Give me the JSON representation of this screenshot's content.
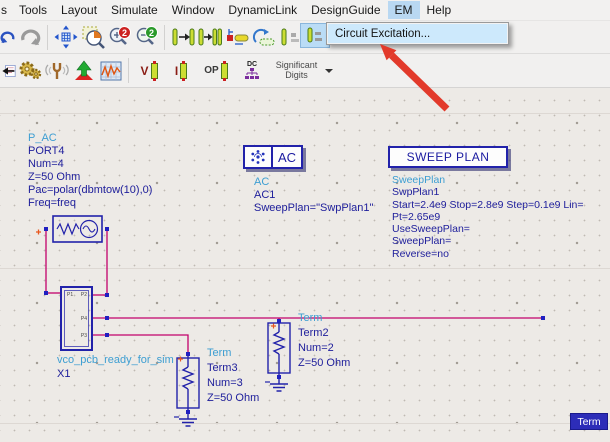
{
  "window": {
    "menu_items": [
      "s",
      "Tools",
      "Layout",
      "Simulate",
      "Window",
      "DynamicLink",
      "DesignGuide",
      "EM",
      "Help"
    ],
    "active_menu": "EM"
  },
  "em_menu": {
    "item": "Circuit Excitation..."
  },
  "toolbar_row1": {
    "icons": [
      "undo",
      "redo",
      "zoom-to-fit",
      "zoom-area",
      "zoom-in-2x",
      "zoom-out-2x",
      "insert-pin",
      "insert-pin-double",
      "push-into",
      "pop-out",
      "pin-tool-hovered"
    ]
  },
  "toolbar_row2": {
    "icons": [
      "back-annotate",
      "simulation-settings",
      "tune",
      "optimize",
      "data-display",
      "voltage-label",
      "current-label",
      "op-label",
      "dc-annotation"
    ],
    "significant_digits": "Significant Digits"
  },
  "schematic": {
    "port": {
      "name": "P_AC",
      "lines": [
        "PORT4",
        "Num=4",
        "Z=50 Ohm",
        "Pac=polar(dbmtow(10),0)",
        "Freq=freq"
      ]
    },
    "ac_ctrl": {
      "box": "AC",
      "name": "AC",
      "lines": [
        "AC1",
        "SweepPlan=\"SwpPlan1\""
      ]
    },
    "sweep_plan": {
      "box": "SWEEP PLAN",
      "name": "SweepPlan",
      "lines": [
        "SwpPlan1",
        "Start=2.4e9 Stop=2.8e9 Step=0.1e9 Lin=",
        "Pt=2.65e9",
        "UseSweepPlan=",
        "SweepPlan=",
        "Reverse=no"
      ]
    },
    "subckt": {
      "name": "vco_pcb_ready_for_sim",
      "refdes": "X1",
      "pins": {
        "p1": "P1",
        "p2": "P2",
        "p4": "P4",
        "p3": "P3"
      }
    },
    "term3": {
      "name": "Term",
      "lines": [
        "Term3",
        "Num=3",
        "Z=50 Ohm"
      ]
    },
    "term2": {
      "name": "Term",
      "lines": [
        "Term2",
        "Num=2",
        "Z=50 Ohm"
      ]
    },
    "selected_label": "Term"
  },
  "colors": {
    "wire": "#c2006b",
    "symbol": "#2222aa",
    "instance_name": "#3d9ed2",
    "param_text": "#20209c",
    "canvas_bg": "#edeae6",
    "menu_highlight": "#b9d8f2",
    "dropdown_highlight": "#cde9fc",
    "annotation_arrow": "#e23a2b"
  }
}
